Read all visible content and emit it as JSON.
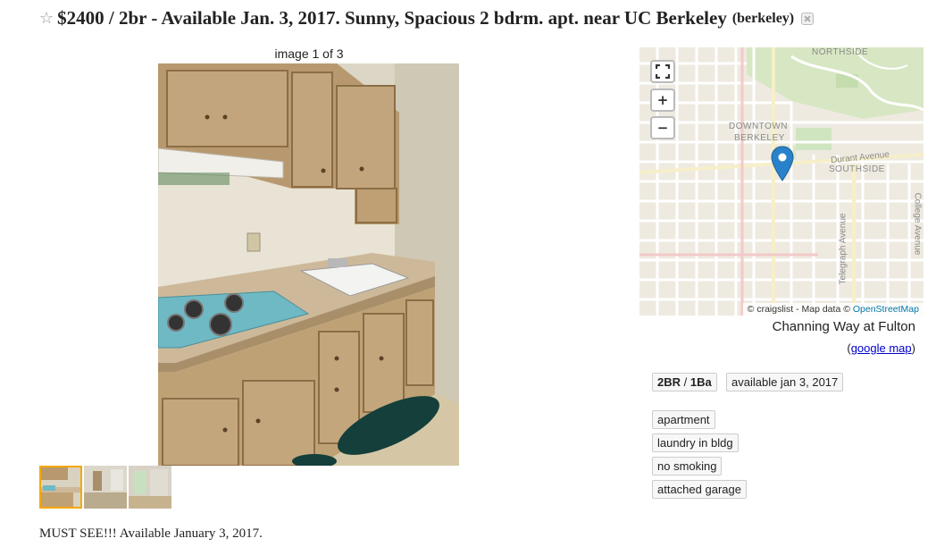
{
  "posting": {
    "title": "$2400 / 2br - Available Jan. 3, 2017. Sunny, Spacious 2 bdrm. apt. near UC Berkeley",
    "hood": "(berkeley)",
    "favorite_icon": "star-icon",
    "hide_icon": "hide-icon"
  },
  "gallery": {
    "counter": "image 1 of 3",
    "thumbnail_count": 3,
    "selected_index": 0
  },
  "map": {
    "labels": {
      "northside": "NORTHSIDE",
      "downtown": "DOWNTOWN",
      "berkeley": "BERKELEY",
      "durant": "Durant Avenue",
      "southside": "SOUTHSIDE",
      "telegraph": "Telegraph Avenue",
      "college": "College Avenue"
    },
    "attribution_prefix": "© craigslist - Map data ©",
    "attribution_link": "OpenStreetMap",
    "fullscreen_label": "⛶",
    "zoom_in_label": "+",
    "zoom_out_label": "−",
    "address": "Channing Way at Fulton",
    "google_map_link": "google map",
    "open_paren": "(",
    "close_paren": ")"
  },
  "attributes": {
    "bedrooms": "2BR",
    "bathrooms": "1Ba",
    "slash": " / ",
    "available": "available jan 3, 2017",
    "tags": [
      "apartment",
      "laundry in bldg",
      "no smoking",
      "attached garage"
    ]
  },
  "body_text": "MUST SEE!!! Available January 3, 2017.",
  "colors": {
    "link": "#0000cc",
    "map_link": "#0078a8",
    "marker": "#2a81cb",
    "thumb_border": "#f6a800"
  }
}
